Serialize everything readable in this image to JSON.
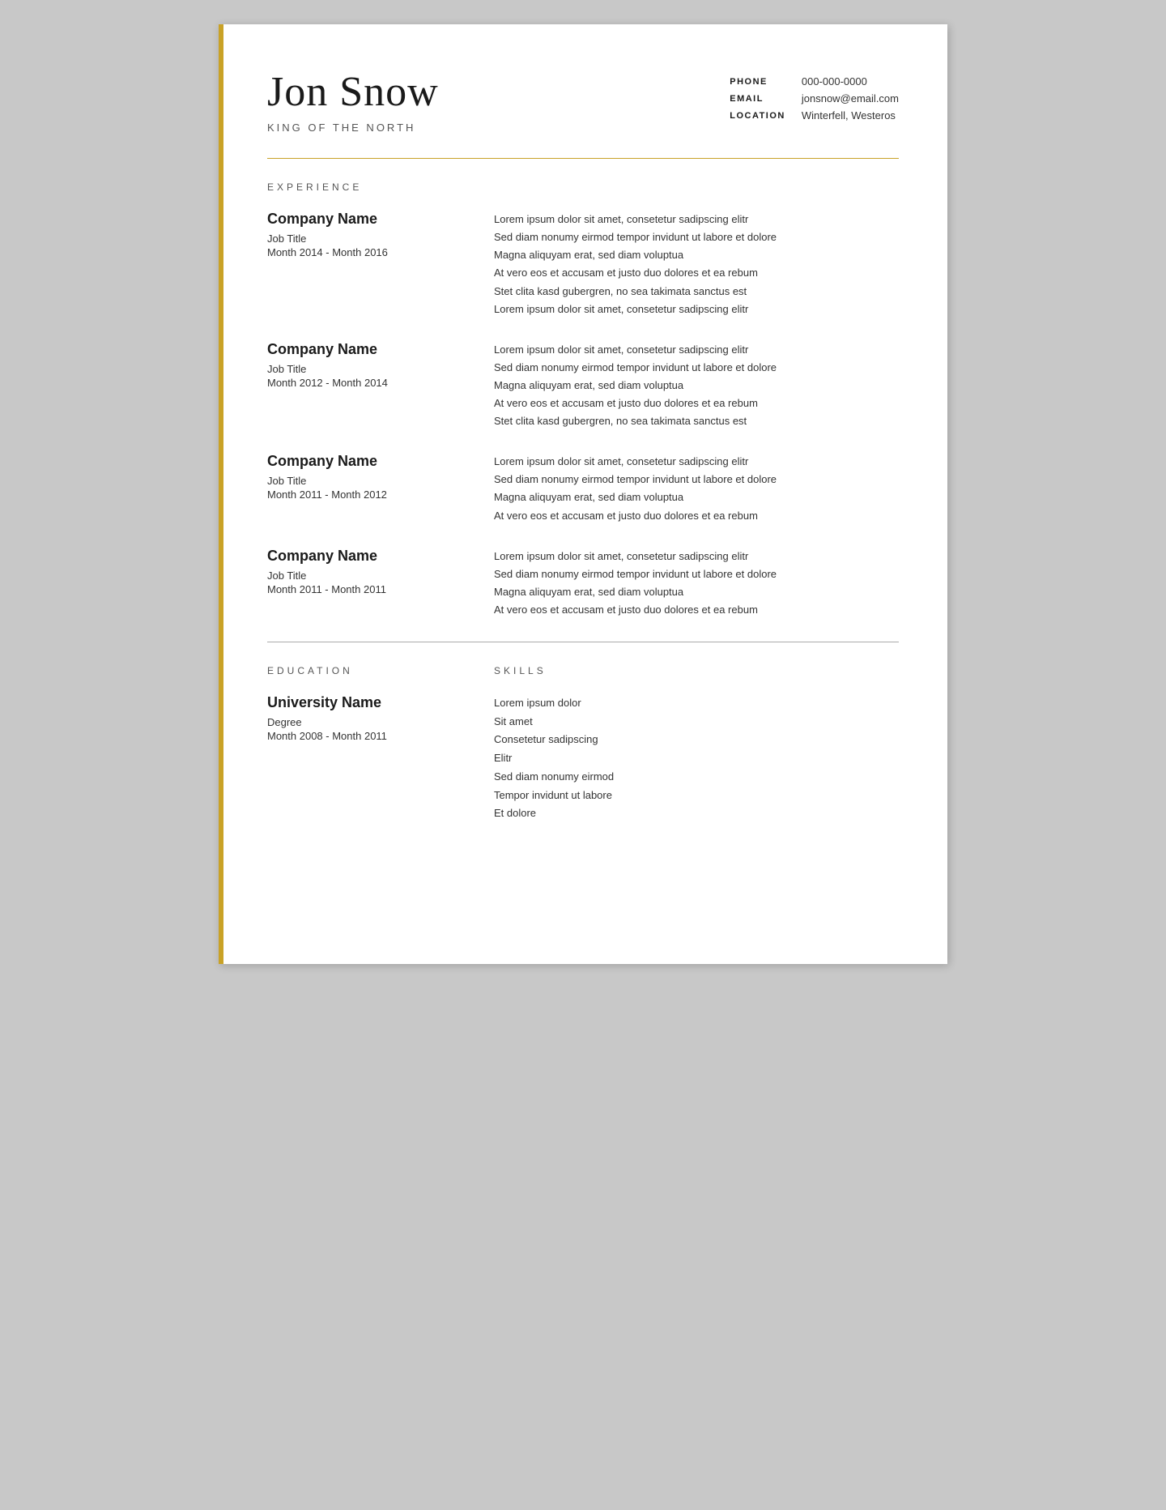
{
  "header": {
    "name": "Jon Snow",
    "subtitle": "King of the North",
    "contact": {
      "phone_label": "PHONE",
      "phone_value": "000-000-0000",
      "email_label": "EMAIL",
      "email_value": "jonsnow@email.com",
      "location_label": "LOCATION",
      "location_value": "Winterfell, Westeros"
    }
  },
  "sections": {
    "experience_title": "EXPERIENCE",
    "education_title": "EDUCATION",
    "skills_title": "SKILLS"
  },
  "experience": [
    {
      "company": "Company Name",
      "title": "Job Title",
      "dates": "Month 2014 - Month 2016",
      "description": [
        "Lorem ipsum dolor sit amet, consetetur sadipscing elitr",
        "Sed diam nonumy eirmod tempor invidunt ut labore et dolore",
        "Magna aliquyam erat, sed diam voluptua",
        "At vero eos et accusam et justo duo dolores et ea rebum",
        "Stet clita kasd gubergren, no sea takimata sanctus est",
        "Lorem ipsum dolor sit amet, consetetur sadipscing elitr"
      ]
    },
    {
      "company": "Company Name",
      "title": "Job Title",
      "dates": "Month 2012 - Month 2014",
      "description": [
        "Lorem ipsum dolor sit amet, consetetur sadipscing elitr",
        "Sed diam nonumy eirmod tempor invidunt ut labore et dolore",
        "Magna aliquyam erat, sed diam voluptua",
        "At vero eos et accusam et justo duo dolores et ea rebum",
        "Stet clita kasd gubergren, no sea takimata sanctus est"
      ]
    },
    {
      "company": "Company Name",
      "title": "Job Title",
      "dates": "Month 2011 - Month 2012",
      "description": [
        "Lorem ipsum dolor sit amet, consetetur sadipscing elitr",
        "Sed diam nonumy eirmod tempor invidunt ut labore et dolore",
        "Magna aliquyam erat, sed diam voluptua",
        "At vero eos et accusam et justo duo dolores et ea rebum"
      ]
    },
    {
      "company": "Company Name",
      "title": "Job Title",
      "dates": "Month 2011 - Month 2011",
      "description": [
        "Lorem ipsum dolor sit amet, consetetur sadipscing elitr",
        "Sed diam nonumy eirmod tempor invidunt ut labore et dolore",
        "Magna aliquyam erat, sed diam voluptua",
        "At vero eos et accusam et justo duo dolores et ea rebum"
      ]
    }
  ],
  "education": {
    "university": "University Name",
    "degree": "Degree",
    "dates": "Month 2008 - Month 2011"
  },
  "skills": [
    "Lorem ipsum dolor",
    "Sit amet",
    "Consetetur sadipscing",
    "Elitr",
    "Sed diam nonumy eirmod",
    "Tempor invidunt ut labore",
    "Et dolore"
  ]
}
